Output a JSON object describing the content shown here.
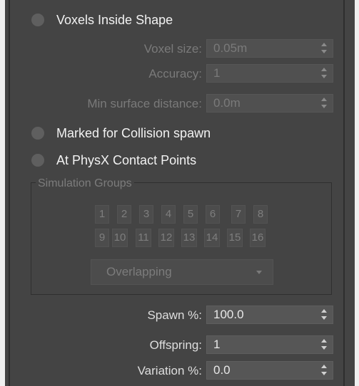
{
  "emission_options": {
    "voxels_inside_shape": "Voxels Inside Shape",
    "marked_for_collision_spawn": "Marked for Collision spawn",
    "at_physx_contact_points": "At PhysX Contact Points"
  },
  "voxel_fields": {
    "voxel_size": {
      "label": "Voxel size:",
      "value": "0.05m"
    },
    "accuracy": {
      "label": "Accuracy:",
      "value": "1"
    },
    "min_surface_distance": {
      "label": "Min surface distance:",
      "value": "0.0m"
    }
  },
  "simulation_groups": {
    "title": "Simulation Groups",
    "buttons": [
      "1",
      "2",
      "3",
      "4",
      "5",
      "6",
      "7",
      "8",
      "9",
      "10",
      "11",
      "12",
      "13",
      "14",
      "15",
      "16"
    ],
    "mode": "Overlapping"
  },
  "spawn_fields": {
    "spawn_pct": {
      "label": "Spawn %:",
      "value": "100.0"
    },
    "offspring": {
      "label": "Offspring:",
      "value": "1"
    },
    "variation_pct": {
      "label": "Variation %:",
      "value": "0.0"
    }
  }
}
